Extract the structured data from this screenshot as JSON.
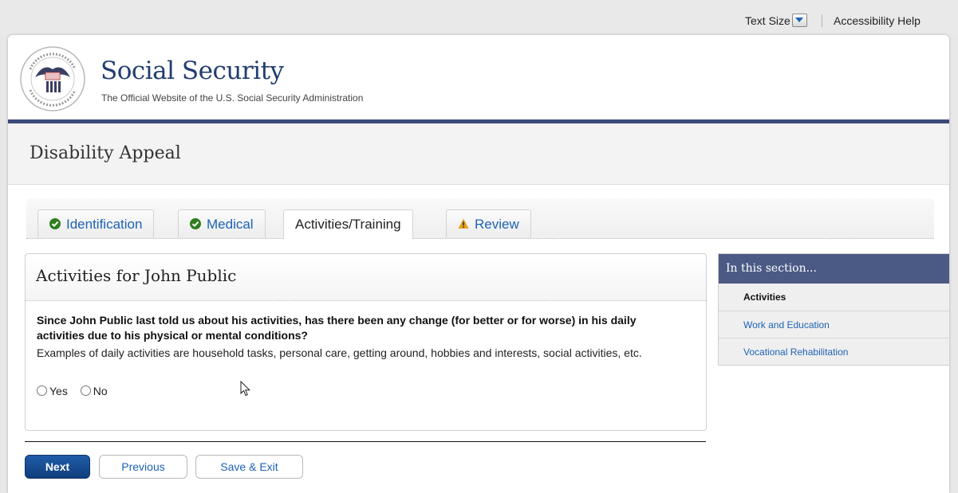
{
  "topbar": {
    "text_size_label": "Text Size",
    "accessibility_label": "Accessibility Help"
  },
  "header": {
    "site_title": "Social Security",
    "site_subtitle": "The Official Website of the U.S. Social Security Administration",
    "seal_text": "SOCIAL SECURITY ADMINISTRATION USA"
  },
  "page_title": "Disability Appeal",
  "tabs": [
    {
      "label": "Identification",
      "status": "complete",
      "icon": "check-circle-icon"
    },
    {
      "label": "Medical",
      "status": "complete",
      "icon": "check-circle-icon"
    },
    {
      "label": "Activities/Training",
      "status": "active"
    },
    {
      "label": "Review",
      "status": "warning",
      "icon": "warning-icon"
    }
  ],
  "panel": {
    "heading": "Activities for John Public",
    "question": "Since John Public last told us about his activities, has there been any change (for better or for worse) in his daily activities due to his physical or mental conditions?",
    "help": "Examples of daily activities are household tasks, personal care, getting around, hobbies and interests, social activities, etc.",
    "options": [
      "Yes",
      "No"
    ],
    "selected": null
  },
  "buttons": {
    "next": "Next",
    "previous": "Previous",
    "save_exit": "Save & Exit"
  },
  "sidebar": {
    "heading": "In this section...",
    "items": [
      {
        "label": "Activities",
        "current": true
      },
      {
        "label": "Work and Education",
        "current": false
      },
      {
        "label": "Vocational Rehabilitation",
        "current": false
      }
    ]
  },
  "colors": {
    "brand_navy": "#223d70",
    "tab_link": "#1d62b5",
    "primary_button": "#174c8f",
    "sidebar_header": "#4a5a85",
    "check_green": "#2f7d1f",
    "warning_amber": "#e5a21c"
  }
}
